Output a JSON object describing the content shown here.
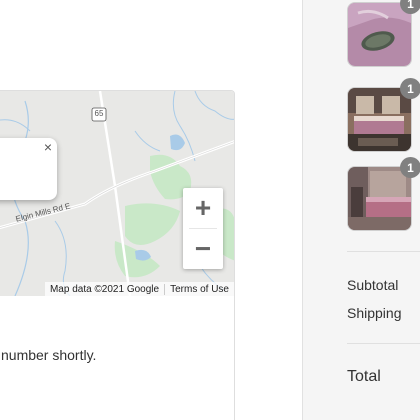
{
  "map": {
    "attribution": "Map data ©2021 Google",
    "terms": "Terms of Use",
    "road_label": "Elgin Mills Rd E",
    "highway_shield": "65",
    "zoom_in_label": "+",
    "zoom_out_label": "−",
    "popup_close_label": "×"
  },
  "main": {
    "message": "number shortly."
  },
  "summary": {
    "items": [
      {
        "name": "silk-eye-mask",
        "quantity": "1"
      },
      {
        "name": "bedroom-set-1",
        "quantity": "1"
      },
      {
        "name": "bedroom-set-2",
        "quantity": "1"
      }
    ],
    "subtotal_label": "Subtotal",
    "shipping_label": "Shipping",
    "total_label": "Total"
  },
  "colors": {
    "sidebar_bg": "#f5f5f5",
    "badge_bg": "#808080",
    "map_bg": "#e8e8e6",
    "map_water": "#a9cbe8",
    "map_park": "#c9e8c8"
  }
}
